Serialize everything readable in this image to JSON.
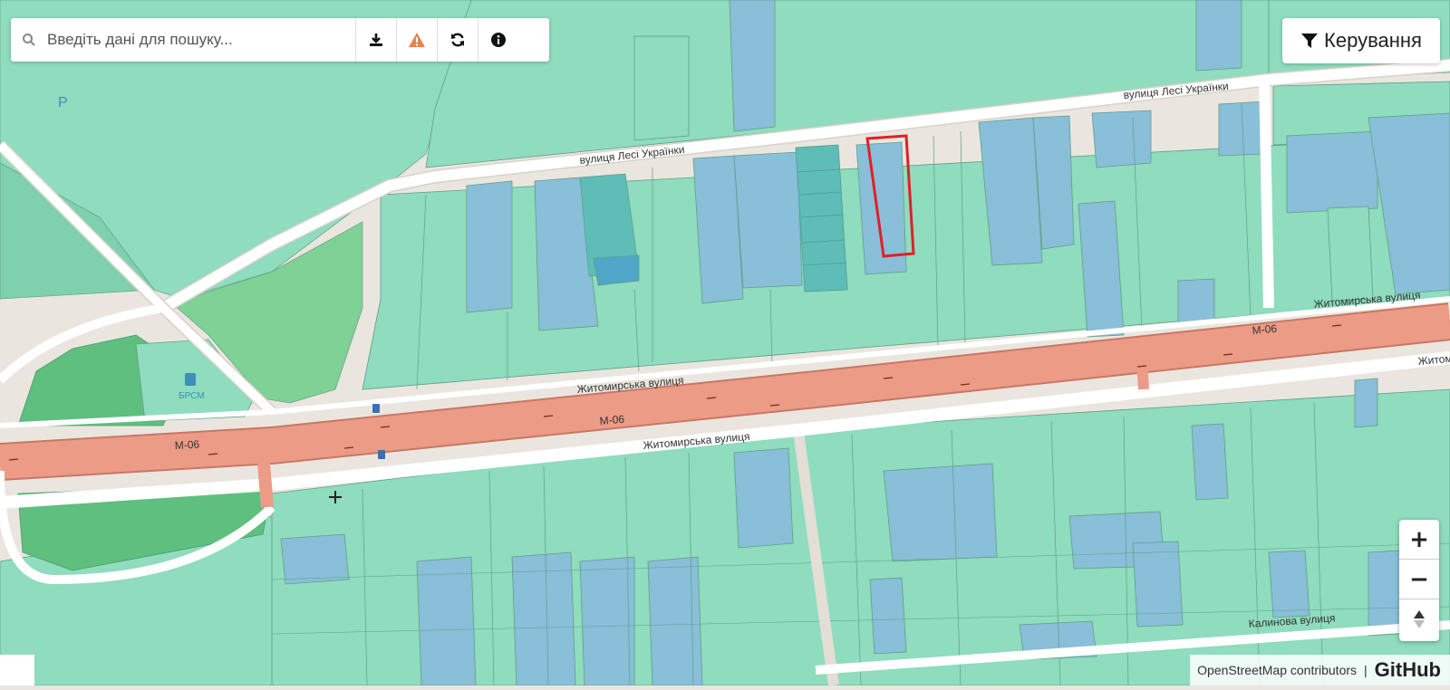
{
  "search": {
    "placeholder": "Введіть дані для пошуку..."
  },
  "toolbar": {
    "download_icon": "download-icon",
    "warning_icon": "warning-icon",
    "refresh_icon": "refresh-icon",
    "info_icon": "info-icon",
    "warning_color": "#e8824a"
  },
  "control": {
    "label": "Керування",
    "icon": "filter-icon"
  },
  "zoom": {
    "in_label": "+",
    "out_label": "−",
    "reset_icon": "north-arrow-icon"
  },
  "attribution": {
    "text": "OpenStreetMap contributors",
    "separator": "|",
    "logo": "GitHub"
  },
  "map": {
    "labels": {
      "street_lesi_top": "вулиця Лесі Українки",
      "street_lesi_left": "вулиця Лесі Українки",
      "street_zhytomyr_right": "Житомирська вулиця",
      "street_zhytomyr_mid": "Житомирська вулиця",
      "street_zhytomyr_bottom": "Житомирська вулиця",
      "street_zhytomyr_edge": "Житом",
      "road_m06_left": "М-06",
      "road_m06_mid": "М-06",
      "road_m06_right": "М-06",
      "street_kalynova": "Калинова вулиця",
      "parking": "P",
      "fuel_station": "БРСМ"
    },
    "colors": {
      "parcel_green": "#8fdcbe",
      "parcel_blue": "#89bfd8",
      "parcel_teal": "#5fbdb8",
      "highway": "#ec9b86",
      "road": "#ffffff",
      "background": "#eae6df",
      "selection": "#e0202a",
      "park": "#74cf8e"
    }
  }
}
